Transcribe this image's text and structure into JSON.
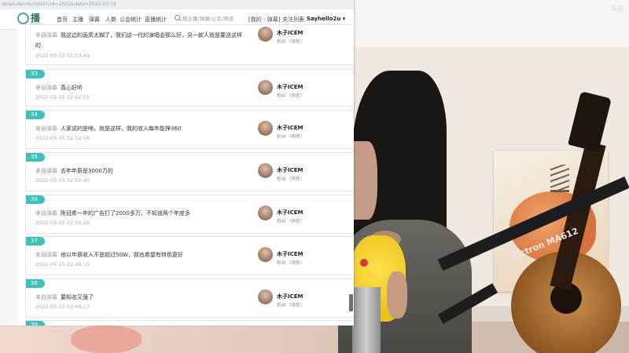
{
  "browser": {
    "url": "detail-danmu.html?cid=2022&date=2022-05-15"
  },
  "nav": {
    "logo_text": "播酱",
    "logo_sub": "BoJiang",
    "items": [
      "首页",
      "主播",
      "弹幕",
      "人数",
      "公会统计",
      "直播统计"
    ],
    "search_placeholder": "搜主播/弹幕/公会/频道",
    "links": [
      "[我的 - 弹幕]",
      "关注列表",
      "Sayhello2u ▾"
    ]
  },
  "danmu": [
    {
      "rank": "",
      "from": "来自弹幕",
      "text": "我这边的画质太糊了，我们这一代的演唱会那么好，另一款人就是要送这样",
      "text2": "的",
      "time": "2022-05-15 02:53:49",
      "user": "木子ICEM",
      "role": "粉丝（萌新）"
    },
    {
      "rank": "33",
      "from": "来自弹幕",
      "text": "真心好听",
      "time": "2022-05-15 02:52:51",
      "user": "木子ICEM",
      "role": "粉丝（萌新）"
    },
    {
      "rank": "34",
      "from": "来自弹幕",
      "text": "人家说的是啥，就是这样，我的收入每年能挣360",
      "time": "2022-05-15 02:52:16",
      "user": "木子ICEM",
      "role": "粉丝（萌新）"
    },
    {
      "rank": "35",
      "from": "来自弹幕",
      "text": "去年年薪是3000万的",
      "time": "2022-05-15 02:50:40",
      "user": "木子ICEM",
      "role": "粉丝（萌新）"
    },
    {
      "rank": "36",
      "from": "来自弹幕",
      "text": "陈冠希一年的广告打了2000多万，不知道两个年度多",
      "time": "2022-05-15 02:50:26",
      "user": "木子ICEM",
      "role": "粉丝（萌新）"
    },
    {
      "rank": "37",
      "from": "来自弹幕",
      "text": "他以年薪收入不是超过50W，我也希望有特色更好",
      "time": "2022-05-15 02:49:15",
      "user": "木子ICEM",
      "role": "粉丝（萌新）"
    },
    {
      "rank": "38",
      "from": "来自弹幕",
      "text": "要知名又强了",
      "time": "2022-05-15 02:48:17",
      "user": "木子ICEM",
      "role": "粉丝（萌新）"
    },
    {
      "rank": "39",
      "from": "",
      "text": "",
      "time": "",
      "user": "",
      "role": ""
    }
  ],
  "video": {
    "mic_brand": "Alctron MA612",
    "watermark": "斗鱼"
  }
}
